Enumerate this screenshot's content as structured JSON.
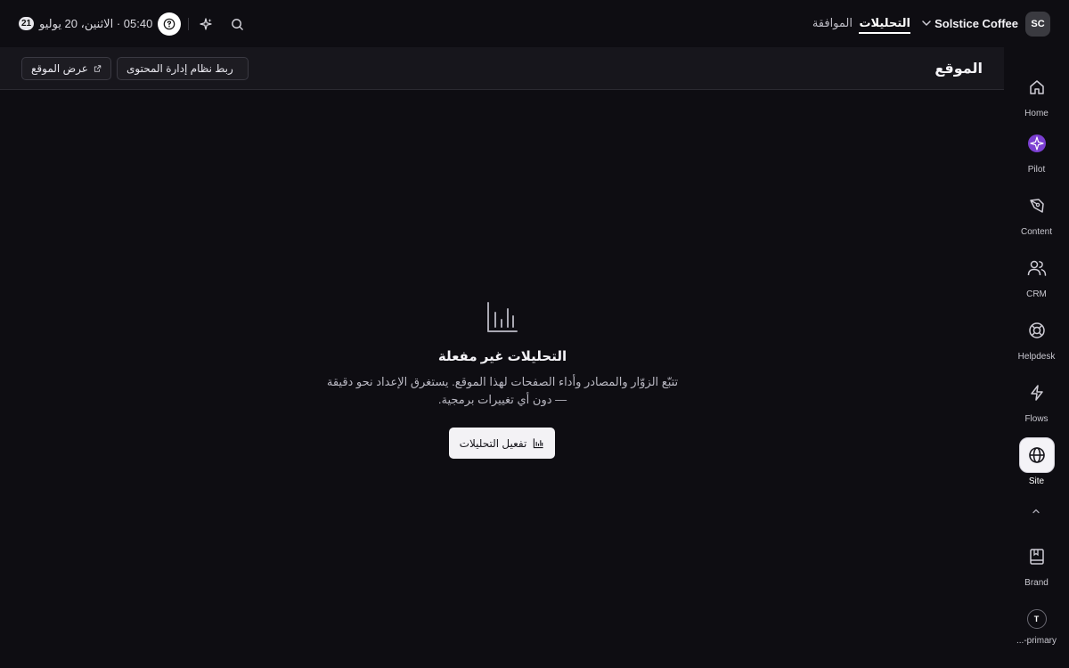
{
  "topbar": {
    "workspace_initials": "SC",
    "workspace_name": "Solstice Coffee",
    "nav": [
      {
        "label": "التحليلات",
        "active": true
      },
      {
        "label": "الموافقة",
        "active": false
      }
    ],
    "datetime": "05:40 · الاثنين، 20 يوليو",
    "day_badge": "21",
    "icons": [
      "search-icon",
      "sparkles-icon",
      "help-icon",
      "chevron-down-icon"
    ]
  },
  "header": {
    "title": "الموقع",
    "buttons": [
      {
        "label": "ربط نظام إدارة المحتوى",
        "icon": "database-icon"
      },
      {
        "label": "عرض الموقع",
        "icon": "external-link-icon"
      }
    ]
  },
  "empty_state": {
    "icon": "bar-chart-icon",
    "title": "التحليلات غير مفعلة",
    "description": "تتبّع الزوّار والمصادر وأداء الصفحات لهذا الموقع. يستغرق الإعداد نحو دقيقة — دون أي تغييرات برمجية.",
    "cta_label": "تفعيل التحليلات"
  },
  "rail": {
    "items": [
      {
        "label": "Home",
        "icon": "home-icon"
      },
      {
        "label": "Pilot",
        "icon": "pilot-icon"
      },
      {
        "label": "Content",
        "icon": "pen-tool-icon"
      },
      {
        "label": "CRM",
        "icon": "users-icon"
      },
      {
        "label": "Helpdesk",
        "icon": "lifebuoy-icon"
      },
      {
        "label": "Flows",
        "icon": "zap-icon"
      },
      {
        "label": "Site",
        "icon": "globe-icon",
        "active": true
      }
    ],
    "bottom": [
      {
        "label": "Brand",
        "icon": "book-icon"
      },
      {
        "label": "...-primary",
        "avatar": "T"
      }
    ]
  },
  "colors": {
    "background": "#0e0d12",
    "subheader": "#17161c",
    "pilot_accent": "#7b3fd1"
  }
}
